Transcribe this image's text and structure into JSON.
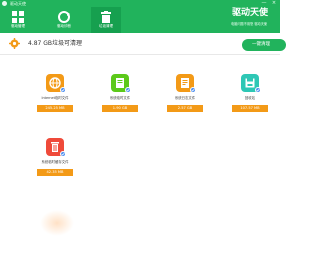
{
  "window": {
    "app_title": "驱动天使",
    "minimize": "—",
    "close": "×"
  },
  "tabs": [
    {
      "label": "驱动管理",
      "icon": "grid-icon"
    },
    {
      "label": "驱动诊断",
      "icon": "refresh-icon"
    },
    {
      "label": "垃圾清理",
      "icon": "trash-icon",
      "active": true
    }
  ],
  "brand": {
    "name": "驱动天使",
    "subtitle": "电脑问题不用愁 驱动天使"
  },
  "summary": {
    "text": "4.87 GB垃圾可清理",
    "clean_button": "一键清理"
  },
  "items": [
    {
      "label": "Internet临时文件",
      "size": "245.25 MB",
      "color": "#f39a17",
      "icon": "globe-icon"
    },
    {
      "label": "系统临时文件",
      "size": "1.90 GB",
      "color": "#5cc91a",
      "icon": "document-icon"
    },
    {
      "label": "系统日志文件",
      "size": "2.57 GB",
      "color": "#f39a17",
      "icon": "log-file-icon"
    },
    {
      "label": "回收站",
      "size": "107.57 MB",
      "color": "#2ec7b5",
      "icon": "save-icon"
    },
    {
      "label": "系统临时缓存文件",
      "size": "42.35 MB",
      "color": "#ef4a3a",
      "icon": "bin-icon"
    }
  ],
  "colors": {
    "brand_green": "#21b35c",
    "orange": "#f39a17",
    "badge_blue": "#4d8ff0"
  }
}
